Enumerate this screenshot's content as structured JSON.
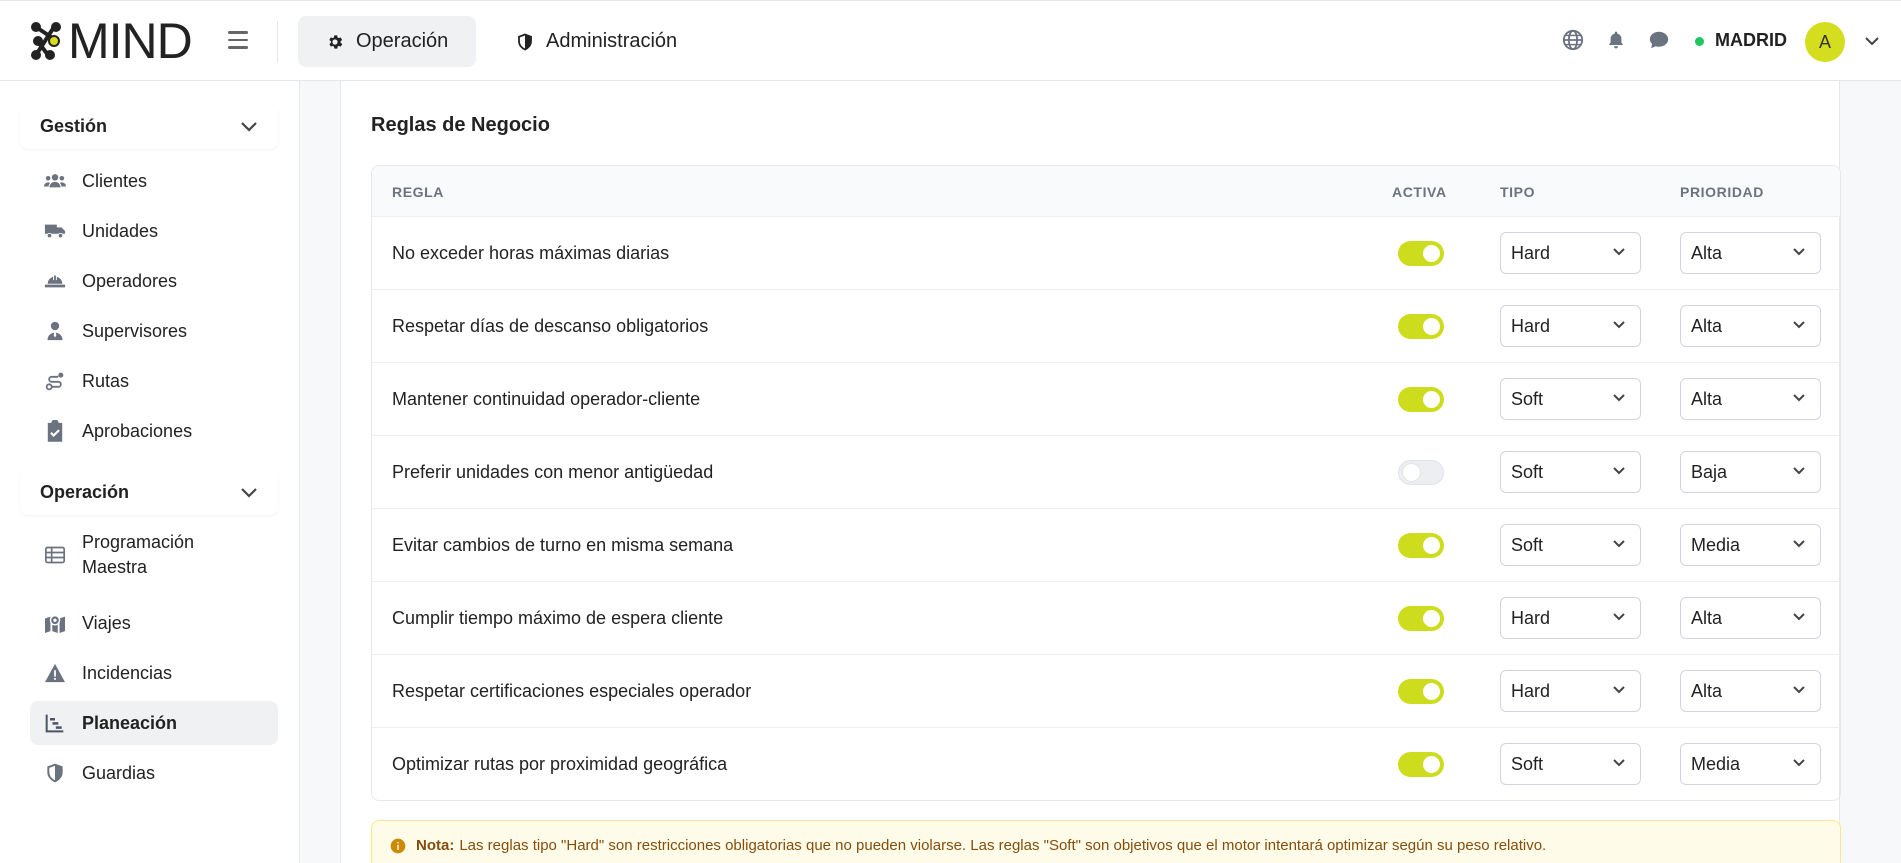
{
  "app": {
    "logo_text": "MIND"
  },
  "nav": {
    "tabs": [
      {
        "label": "Operación",
        "icon": "gear-icon"
      },
      {
        "label": "Administración",
        "icon": "shield-icon"
      }
    ],
    "location": "MADRID",
    "avatar_initial": "A"
  },
  "sidebar": {
    "sections": [
      {
        "title": "Gestión",
        "items": [
          {
            "label": "Clientes",
            "icon": "users-icon"
          },
          {
            "label": "Unidades",
            "icon": "truck-icon"
          },
          {
            "label": "Operadores",
            "icon": "hard-hat-icon"
          },
          {
            "label": "Supervisores",
            "icon": "user-tie-icon"
          },
          {
            "label": "Rutas",
            "icon": "route-icon"
          },
          {
            "label": "Aprobaciones",
            "icon": "clipboard-check-icon"
          }
        ]
      },
      {
        "title": "Operación",
        "items": [
          {
            "label": "Programación Maestra",
            "icon": "table-list-icon"
          },
          {
            "label": "Viajes",
            "icon": "map-location-icon"
          },
          {
            "label": "Incidencias",
            "icon": "warning-icon"
          },
          {
            "label": "Planeación",
            "icon": "chart-gantt-icon",
            "active": true
          },
          {
            "label": "Guardias",
            "icon": "shield-half-icon"
          }
        ]
      }
    ]
  },
  "main": {
    "title": "Reglas de Negocio",
    "columns": {
      "rule": "REGLA",
      "active": "ACTIVA",
      "type": "TIPO",
      "priority": "PRIORIDAD"
    },
    "rows": [
      {
        "rule": "No exceder horas máximas diarias",
        "active": true,
        "type": "Hard",
        "priority": "Alta"
      },
      {
        "rule": "Respetar días de descanso obligatorios",
        "active": true,
        "type": "Hard",
        "priority": "Alta"
      },
      {
        "rule": "Mantener continuidad operador-cliente",
        "active": true,
        "type": "Soft",
        "priority": "Alta"
      },
      {
        "rule": "Preferir unidades con menor antigüedad",
        "active": false,
        "type": "Soft",
        "priority": "Baja"
      },
      {
        "rule": "Evitar cambios de turno en misma semana",
        "active": true,
        "type": "Soft",
        "priority": "Media"
      },
      {
        "rule": "Cumplir tiempo máximo de espera cliente",
        "active": true,
        "type": "Hard",
        "priority": "Alta"
      },
      {
        "rule": "Respetar certificaciones especiales operador",
        "active": true,
        "type": "Hard",
        "priority": "Alta"
      },
      {
        "rule": "Optimizar rutas por proximidad geográfica",
        "active": true,
        "type": "Soft",
        "priority": "Media"
      }
    ],
    "note": {
      "label": "Nota:",
      "text": "Las reglas tipo \"Hard\" son restricciones obligatorias que no pueden violarse. Las reglas \"Soft\" son objetivos que el motor intentará optimizar según su peso relativo."
    }
  },
  "colors": {
    "accent": "#cddc1d",
    "status_online": "#22c55e",
    "note_bg": "#fefce8",
    "note_text": "#854d0e"
  }
}
